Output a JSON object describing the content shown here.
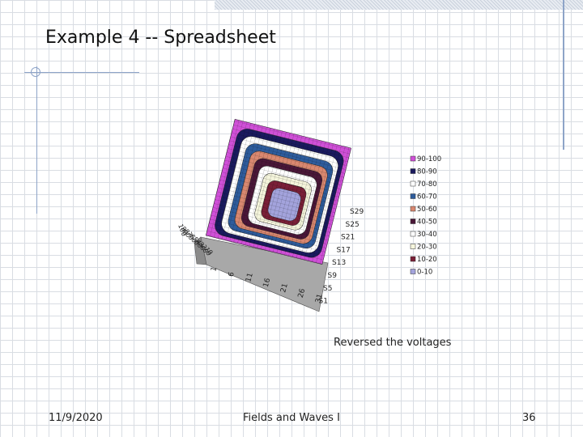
{
  "slide": {
    "title": "Example 4 -- Spreadsheet",
    "caption": "Reversed the voltages"
  },
  "footer": {
    "date": "11/9/2020",
    "center": "Fields and Waves I",
    "page": "36"
  },
  "colors": {
    "accent_rule": "#8ea4c8",
    "grid": "#d9dde3"
  },
  "chart_data": {
    "type": "surface",
    "legend_position": "right",
    "legend": [
      {
        "label": "90-100",
        "color": "#d050d8"
      },
      {
        "label": "80-90",
        "color": "#1a1a5e"
      },
      {
        "label": "70-80",
        "color": "#ffffff"
      },
      {
        "label": "60-70",
        "color": "#2e5c9c"
      },
      {
        "label": "50-60",
        "color": "#d98870"
      },
      {
        "label": "40-50",
        "color": "#4a1738"
      },
      {
        "label": "30-40",
        "color": "#ffffff"
      },
      {
        "label": "20-30",
        "color": "#f5f5dc"
      },
      {
        "label": "10-20",
        "color": "#7a2038"
      },
      {
        "label": "0-10",
        "color": "#a3a3dc"
      }
    ],
    "series_axis_ticks": [
      "S29",
      "S25",
      "S21",
      "S17",
      "S13",
      "S9",
      "S5",
      "S1"
    ],
    "category_axis_ticks": [
      "1",
      "6",
      "11",
      "16",
      "21",
      "26",
      "31"
    ],
    "value_axis_ticks": [
      "100",
      "90",
      "80",
      "70",
      "60",
      "50",
      "40",
      "30",
      "20",
      "10",
      "0"
    ]
  }
}
